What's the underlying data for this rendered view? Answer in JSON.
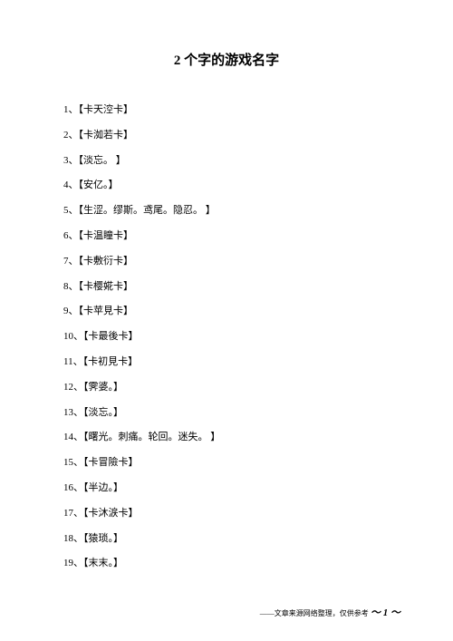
{
  "title": "2 个字的游戏名字",
  "items": [
    "1、【卡天涳卡】",
    "2、【卡洳若卡】",
    "3、【淡忘。 】",
    "4、【安亿。】",
    "5、【生涩。缪斯。鸢尾。隐忍。 】",
    "6、【卡温瞳卡】",
    "7、【卡敷衍卡】",
    "8、【卡樱婲卡】",
    "9、【卡苹見卡】",
    "10、【卡最後卡】",
    "11、【卡初見卡】",
    "12、【霁婆。】",
    "13、【淡忘。】",
    "14、【曙光。刺痛。轮回。迷失。 】",
    "15、【卡冒險卡】",
    "16、【半边。】",
    "17、【卡沐涙卡】",
    "18、【猿琐。】",
    "19、【末末。】"
  ],
  "footer": {
    "source": "——文章来源网络整理，仅供参考",
    "page": "～ 1 ～"
  }
}
